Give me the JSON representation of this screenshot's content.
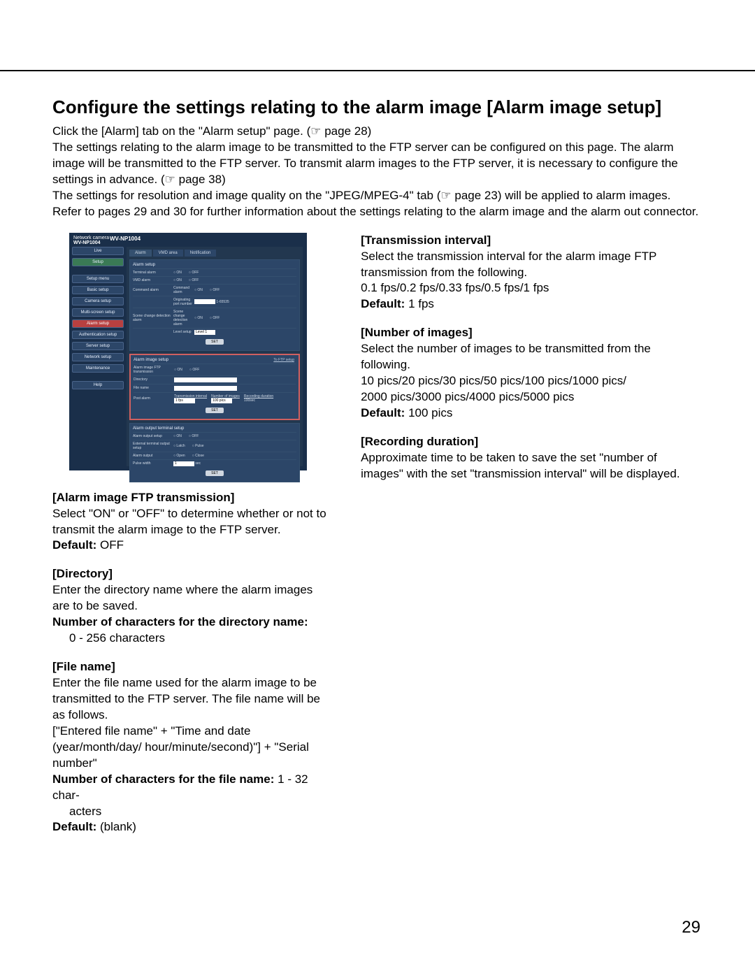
{
  "page_number": "29",
  "title": "Configure the settings relating to the alarm image [Alarm image setup]",
  "intro": {
    "p1a": "Click the [Alarm] tab on the \"Alarm setup\" page. (",
    "p1_ref": "☞ page 28",
    "p1b": ")",
    "p2a": "The settings relating to the alarm image to be transmitted to the FTP server can be configured on this page. The alarm image will be transmitted to the FTP server. To transmit alarm images to the FTP server, it is necessary to configure the settings in advance. (",
    "p2_ref": "☞ page 38",
    "p2b": ")",
    "p3a": "The settings for resolution and image quality on the \"JPEG/MPEG-4\" tab (",
    "p3_ref": "☞ page 23",
    "p3b": ") will be applied to alarm images.",
    "p4": "Refer to pages 29 and 30 for further information about the settings relating to the alarm image and the alarm out connector."
  },
  "left": {
    "ftp": {
      "label": "[Alarm image FTP transmission]",
      "body": "Select \"ON\" or \"OFF\" to determine whether or not to transmit the alarm image to the FTP server.",
      "default_label": "Default:",
      "default_value": " OFF"
    },
    "dir": {
      "label": "[Directory]",
      "body": "Enter the directory name where the alarm images are to be saved.",
      "chars_label": "Number of characters for the directory name:",
      "chars_value": "0 - 256 characters"
    },
    "file": {
      "label": "[File name]",
      "body1": "Enter the file name used for the alarm image to be transmitted to the FTP server. The file name will be as follows.",
      "body2": "[\"Entered file name\" + \"Time and date (year/month/day/ hour/minute/second)\"] + \"Serial number\"",
      "chars_label": "Number of characters for the file name:",
      "chars_value": " 1 - 32 characters",
      "default_label": "Default:",
      "default_value": " (blank)"
    }
  },
  "right": {
    "interval": {
      "label": "[Transmission interval]",
      "body": "Select the transmission interval for the alarm image FTP transmission from the following.",
      "options": "0.1 fps/0.2 fps/0.33 fps/0.5 fps/1 fps",
      "default_label": "Default:",
      "default_value": " 1 fps"
    },
    "images": {
      "label": "[Number of images]",
      "body": "Select the number of images to be transmitted from the following.",
      "options1": "10 pics/20 pics/30 pics/50 pics/100 pics/1000 pics/",
      "options2": "2000 pics/3000 pics/4000 pics/5000 pics",
      "default_label": "Default:",
      "default_value": " 100 pics"
    },
    "duration": {
      "label": "[Recording duration]",
      "body": "Approximate time to be taken to save the set \"number of images\" with the set \"transmission interval\" will be displayed."
    }
  },
  "screenshot": {
    "brand": "Network camera",
    "model": "WV-NP1004",
    "sidebar": {
      "live": "Live",
      "setup": "Setup",
      "setup_menu": "Setup menu",
      "basic": "Basic setup",
      "camera": "Camera setup",
      "multi": "Multi-screen setup",
      "alarm": "Alarm setup",
      "auth": "Authentication setup",
      "server": "Server setup",
      "network": "Network setup",
      "maint": "Maintenance",
      "help": "Help"
    },
    "tabs": {
      "alarm": "Alarm",
      "vmd": "VMD area",
      "notif": "Notification"
    },
    "panel1": {
      "title": "Alarm setup",
      "terminal": "Terminal alarm",
      "vmd": "VMD alarm",
      "cmd": "Command alarm",
      "cmd_sub1": "Command alarm",
      "cmd_sub2": "Originating port number",
      "scene": "Scene change detection alarm",
      "scene_sub": "Scene change detection alarm",
      "level": "Level setup",
      "on": "ON",
      "off": "OFF",
      "port_val": "1-65535",
      "level_val": "Level 1",
      "set": "SET"
    },
    "panel2": {
      "title": "Alarm image setup",
      "link": "To FTP setup",
      "ftp": "Alarm image FTP transmission",
      "dir": "Directory",
      "file": "File name",
      "post": "Post alarm",
      "on": "ON",
      "off": "OFF",
      "h1": "Transmission interval",
      "h2": "Number of images",
      "h3": "Recording duration",
      "v1": "1 fps",
      "v2": "100 pics",
      "v3": "100sec",
      "set": "SET"
    },
    "panel3": {
      "title": "Alarm output terminal setup",
      "out": "Alarm output setup",
      "ext": "External terminal output setup",
      "ao": "Alarm output",
      "pw": "Pulse width",
      "on": "ON",
      "off": "OFF",
      "latch": "Latch",
      "pulse": "Pulse",
      "open": "Open",
      "close": "Close",
      "pw_val": "1",
      "sec": "sec",
      "set": "SET"
    }
  }
}
